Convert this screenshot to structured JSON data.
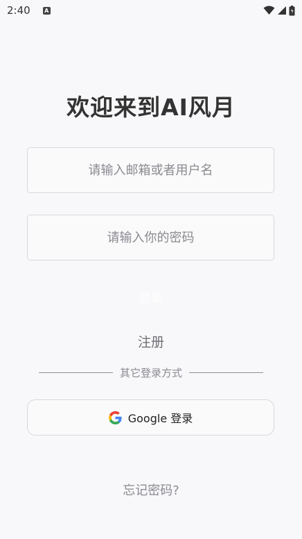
{
  "status_bar": {
    "time": "2:40",
    "notification_icon": "A"
  },
  "header": {
    "title": "欢迎来到AI风月"
  },
  "form": {
    "email_placeholder": "请输入邮箱或者用户名",
    "password_placeholder": "请输入你的密码",
    "login_label": "登录",
    "register_label": "注册"
  },
  "alt_login": {
    "divider_text": "其它登录方式",
    "google_label": "Google 登录",
    "google_icon": "google-g-logo"
  },
  "footer": {
    "forgot_label": "忘记密码?"
  },
  "colors": {
    "background": "#f8f8fa",
    "border": "#d8d8dc",
    "title": "#333333",
    "muted": "#8a8a90"
  }
}
